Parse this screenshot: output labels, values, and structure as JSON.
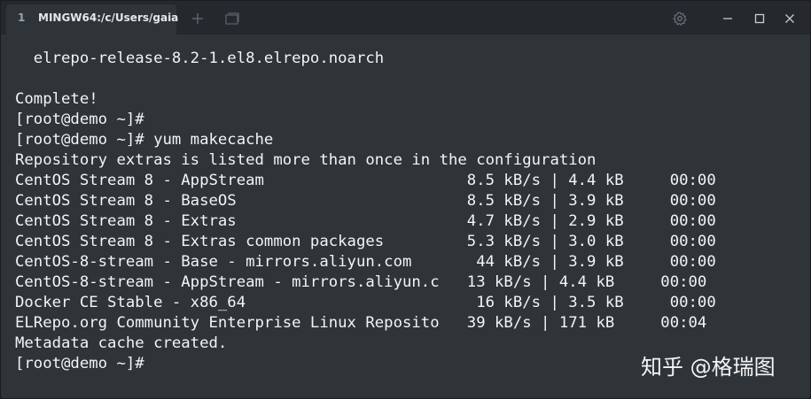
{
  "tab": {
    "index": "1",
    "title": "MINGW64:/c/Users/gaia"
  },
  "icons": {
    "new_tab": "plus-icon",
    "tab_list": "window-icon",
    "settings": "gear-icon",
    "minimize": "minimize-icon",
    "maximize": "maximize-icon",
    "close": "close-icon"
  },
  "terminal": {
    "lines": [
      "  elrepo-release-8.2-1.el8.elrepo.noarch",
      "",
      "Complete!",
      "[root@demo ~]#",
      "[root@demo ~]# yum makecache",
      "Repository extras is listed more than once in the configuration",
      "CentOS Stream 8 - AppStream                      8.5 kB/s | 4.4 kB     00:00",
      "CentOS Stream 8 - BaseOS                         8.5 kB/s | 3.9 kB     00:00",
      "CentOS Stream 8 - Extras                         4.7 kB/s | 2.9 kB     00:00",
      "CentOS Stream 8 - Extras common packages         5.3 kB/s | 3.0 kB     00:00",
      "CentOS-8-stream - Base - mirrors.aliyun.com       44 kB/s | 3.9 kB     00:00",
      "CentOS-8-stream - AppStream - mirrors.aliyun.c   13 kB/s | 4.4 kB     00:00",
      "Docker CE Stable - x86_64                         16 kB/s | 3.5 kB     00:00",
      "ELRepo.org Community Enterprise Linux Reposito   39 kB/s | 171 kB     00:04",
      "Metadata cache created.",
      "[root@demo ~]#"
    ]
  },
  "watermark": "知乎 @格瑞图",
  "colors": {
    "titlebar_bg": "#25292e",
    "terminal_bg": "#2f3438",
    "text": "#f2f4f5"
  }
}
